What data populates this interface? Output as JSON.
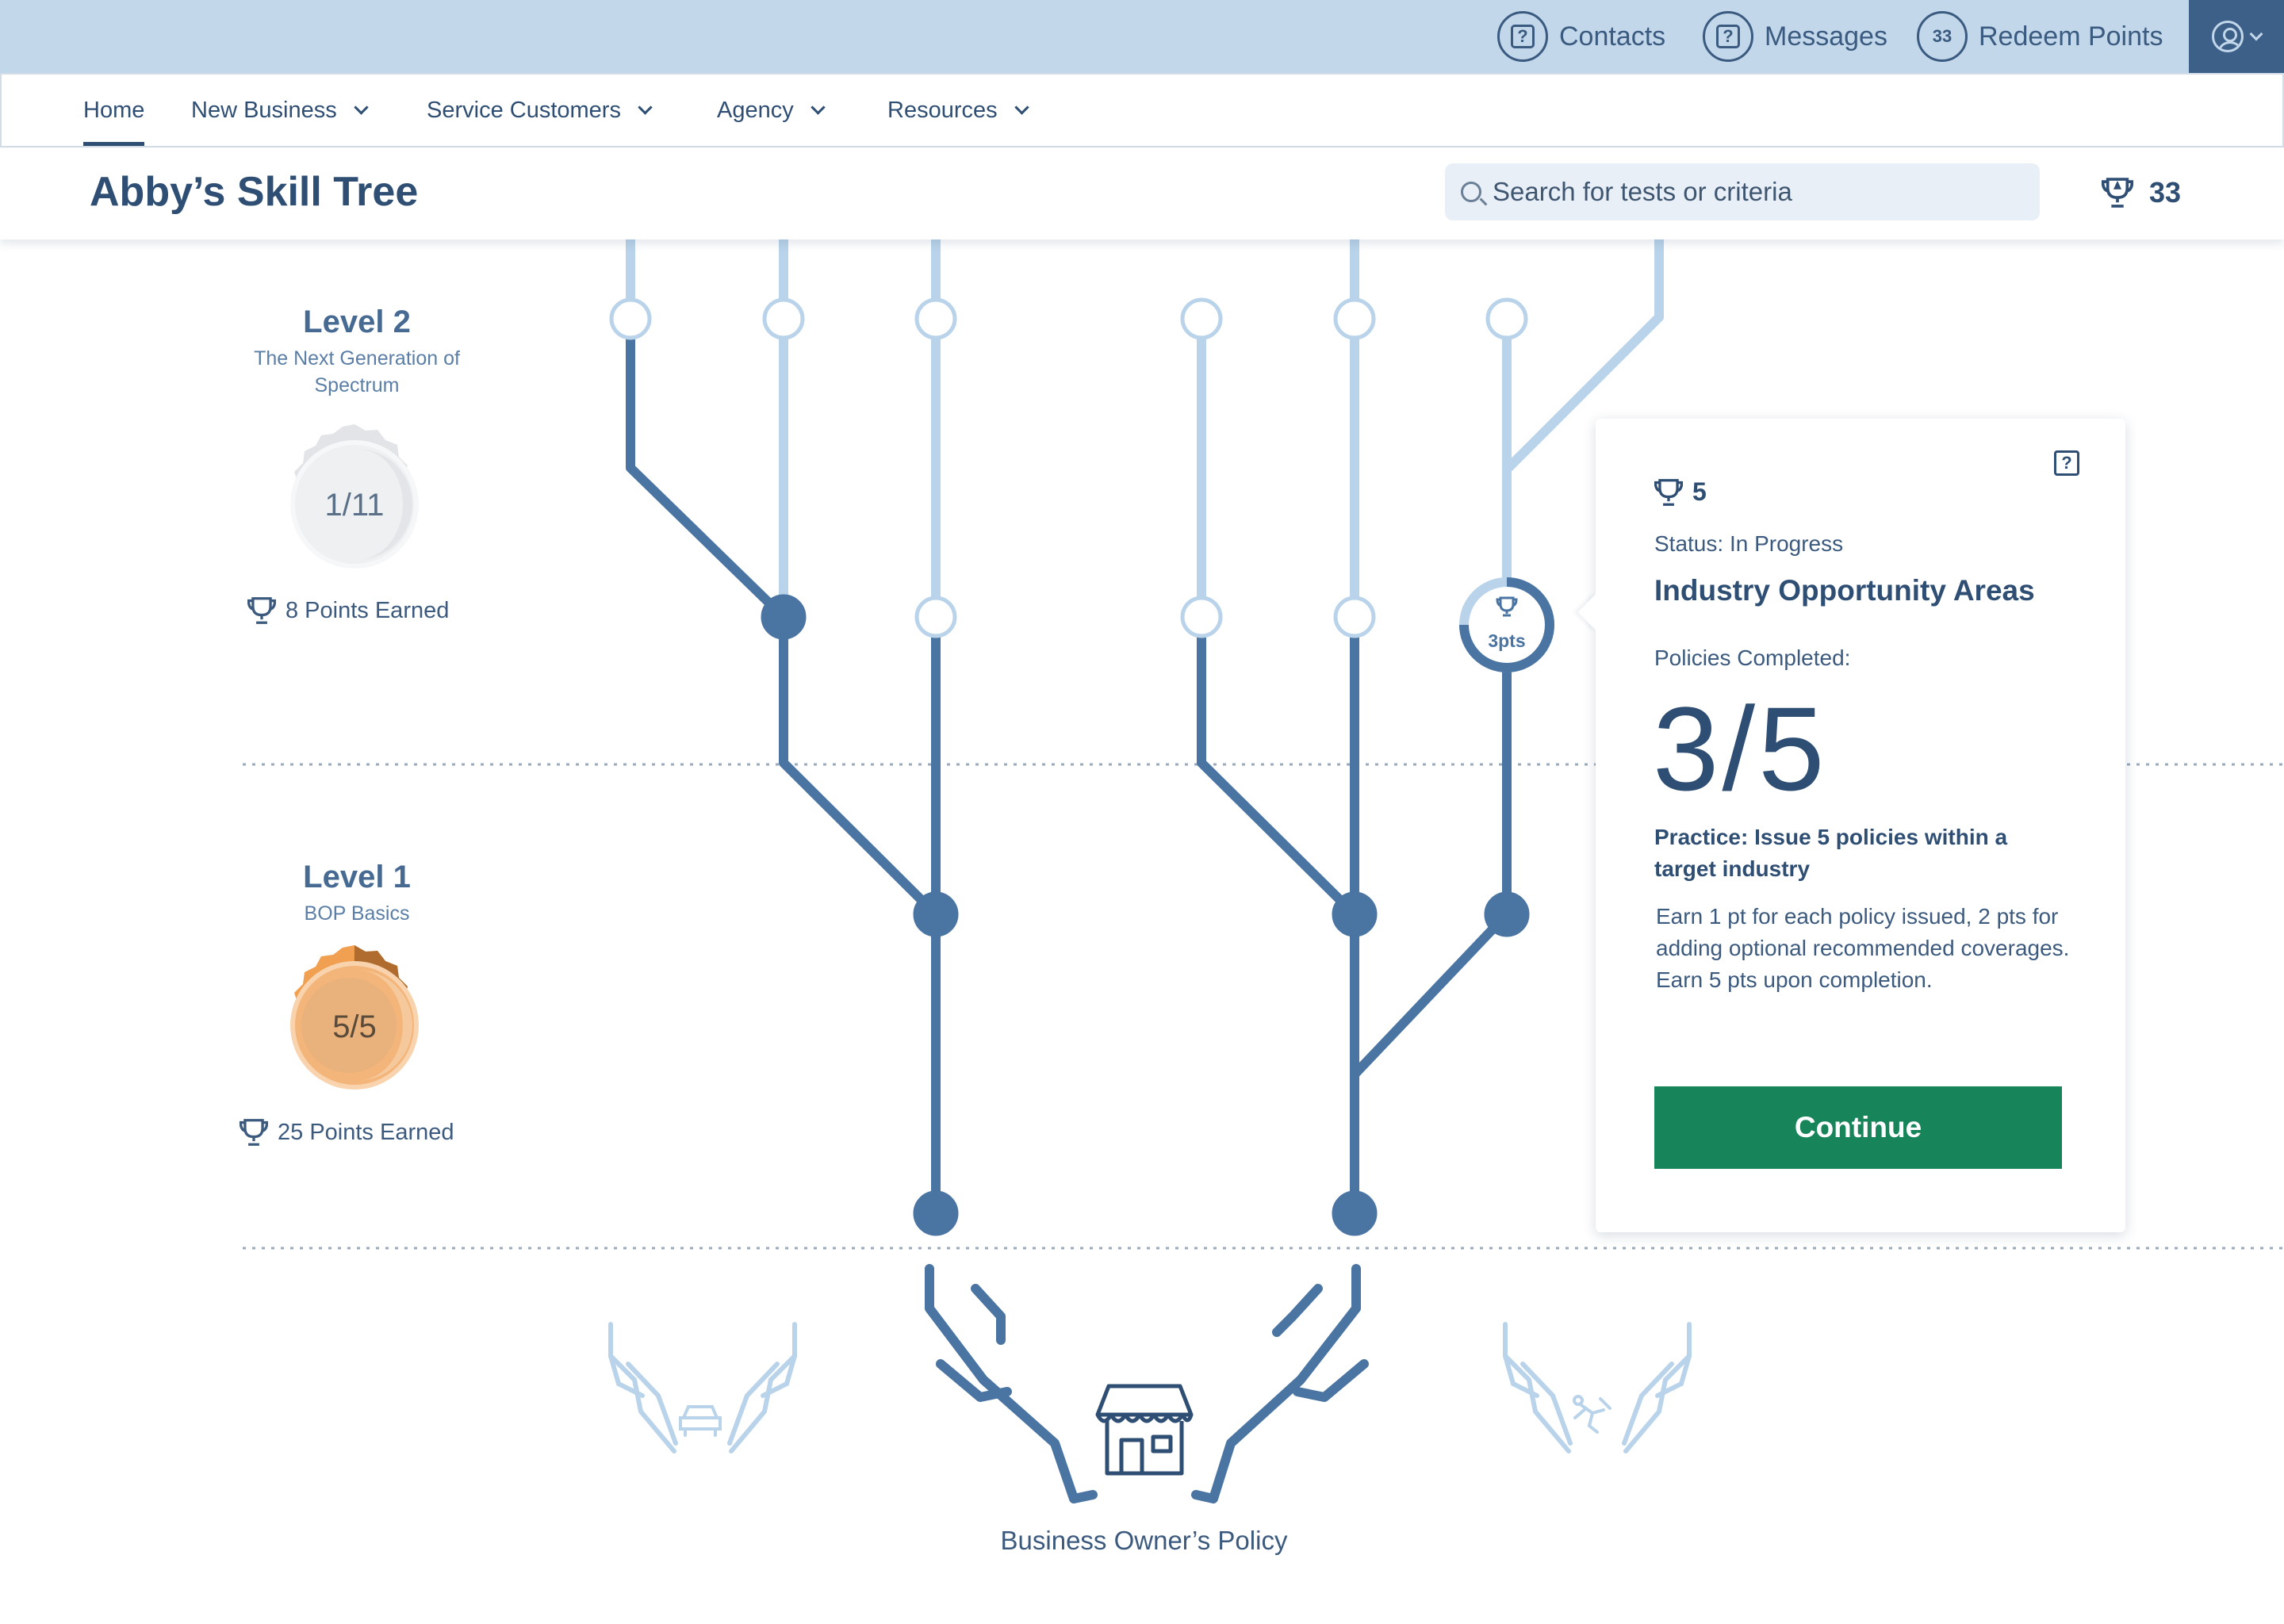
{
  "topbar": {
    "contacts_label": "Contacts",
    "messages_label": "Messages",
    "redeem_count": "33",
    "redeem_label": "Redeem Points",
    "help_glyph": "?"
  },
  "nav": {
    "items": [
      {
        "label": "Home"
      },
      {
        "label": "New Business"
      },
      {
        "label": "Service Customers"
      },
      {
        "label": "Agency"
      },
      {
        "label": "Resources"
      }
    ]
  },
  "header": {
    "title": "Abby’s Skill Tree",
    "search_placeholder": "Search for tests or criteria",
    "points": "33"
  },
  "levels": [
    {
      "title": "Level 2",
      "subtitle_line1": "The Next Generation  of",
      "subtitle_line2": "Spectrum",
      "progress": "1/11",
      "points_earned": "8 Points Earned",
      "badge_color": "#d8dde3"
    },
    {
      "title": "Level 1",
      "subtitle_line1": "BOP Basics",
      "progress": "5/5",
      "points_earned": "25 Points Earned",
      "badge_color": "#f0a050"
    }
  ],
  "tree": {
    "active_node_label": "3pts",
    "root_label": "Business Owner’s Policy",
    "colors": {
      "completed": "#4a74a2",
      "locked": "#b9d3ea",
      "line_dotted": "#9aaabb"
    }
  },
  "popover": {
    "points": "5",
    "status": "Status: In Progress",
    "title": "Industry Opportunity Areas",
    "policies_label": "Policies Completed:",
    "progress": "3/5",
    "practice": "Practice: Issue 5 policies within a target industry",
    "description": "Earn 1 pt for each policy issued, 2 pts for adding optional recommended coverages. Earn 5 pts upon completion.",
    "button_label": "Continue",
    "button_color": "#17845a"
  },
  "icons": [
    "help-icon",
    "profile-icon",
    "chevron-down-icon",
    "search-icon",
    "trophy-icon",
    "car-icon",
    "storefront-icon",
    "person-falling-icon"
  ]
}
